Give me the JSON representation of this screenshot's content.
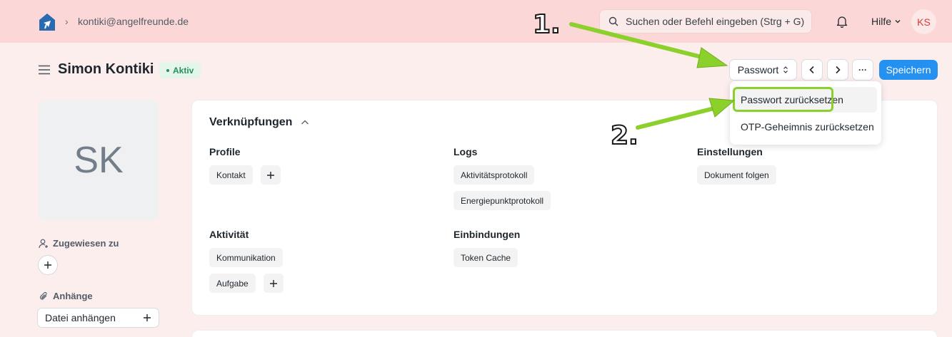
{
  "navbar": {
    "breadcrumb_sep": "›",
    "breadcrumb": "kontiki@angelfreunde.de",
    "search_placeholder": "Suchen oder Befehl eingeben (Strg + G)",
    "help_label": "Hilfe",
    "user_initials": "KS"
  },
  "page": {
    "title": "Simon Kontiki",
    "status": "Aktiv"
  },
  "toolbar": {
    "password_label": "Passwort",
    "more_label": "···",
    "save_label": "Speichern"
  },
  "dropdown": {
    "items": [
      "Passwort zurücksetzen",
      "OTP-Geheimnis zurücksetzen"
    ]
  },
  "sidebar": {
    "avatar_initials": "SK",
    "assigned_label": "Zugewiesen zu",
    "attachments_label": "Anhänge",
    "attach_button": "Datei anhängen"
  },
  "connections": {
    "title": "Verknüpfungen",
    "groups": [
      {
        "title": "Profile",
        "items": [
          "Kontakt"
        ]
      },
      {
        "title": "Logs",
        "items": [
          "Aktivitätsprotokoll",
          "Energiepunktprotokoll"
        ]
      },
      {
        "title": "Einstellungen",
        "items": [
          "Dokument folgen"
        ]
      },
      {
        "title": "Aktivität",
        "items": [
          "Kommunikation",
          "Aufgabe"
        ]
      },
      {
        "title": "Einbindungen",
        "items": [
          "Token Cache"
        ]
      }
    ]
  },
  "annotations": {
    "step1": "1.",
    "step2": "2."
  },
  "colors": {
    "navbar_bg": "#fcd7d7",
    "page_bg": "#fdeeee",
    "primary": "#2490ef",
    "status_green": "#278f5e",
    "annotation_green": "#8cd02c"
  }
}
